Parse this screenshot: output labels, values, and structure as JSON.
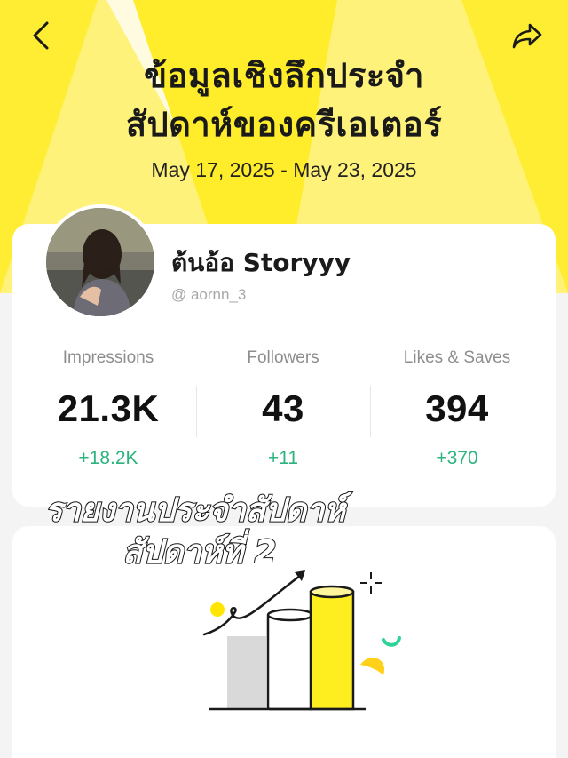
{
  "header": {
    "title_line1": "ข้อมูลเชิงลึกประจำ",
    "title_line2": "สัปดาห์ของครีเอเตอร์",
    "date_range": "May 17, 2025 - May 23, 2025",
    "back_icon": "chevron-left-icon",
    "share_icon": "share-icon"
  },
  "profile": {
    "name": "ต้นอ้อ Storyyy",
    "handle": "@ aornn_3"
  },
  "stats": [
    {
      "label": "Impressions",
      "value": "21.3K",
      "delta": "+18.2K"
    },
    {
      "label": "Followers",
      "value": "43",
      "delta": "+11"
    },
    {
      "label": "Likes & Saves",
      "value": "394",
      "delta": "+370"
    }
  ],
  "overlay": {
    "line1": "รายงานประจำสัปดาห์",
    "line2": "สัปดาห์ที่ 2"
  },
  "colors": {
    "accent_yellow": "#fff07a",
    "ray_yellow": "#ffef3a",
    "delta_green": "#2db37e",
    "bar_yellow": "#ffee1f"
  }
}
